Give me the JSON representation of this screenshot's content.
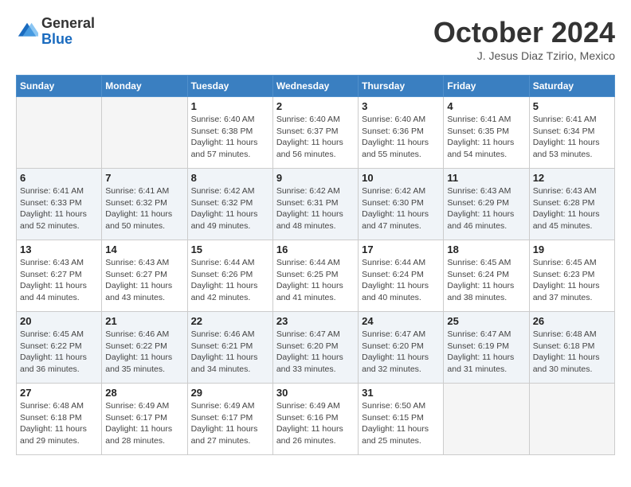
{
  "logo": {
    "general": "General",
    "blue": "Blue"
  },
  "title": "October 2024",
  "subtitle": "J. Jesus Diaz Tzirio, Mexico",
  "days_of_week": [
    "Sunday",
    "Monday",
    "Tuesday",
    "Wednesday",
    "Thursday",
    "Friday",
    "Saturday"
  ],
  "weeks": [
    [
      {
        "day": "",
        "detail": ""
      },
      {
        "day": "",
        "detail": ""
      },
      {
        "day": "1",
        "detail": "Sunrise: 6:40 AM\nSunset: 6:38 PM\nDaylight: 11 hours and 57 minutes."
      },
      {
        "day": "2",
        "detail": "Sunrise: 6:40 AM\nSunset: 6:37 PM\nDaylight: 11 hours and 56 minutes."
      },
      {
        "day": "3",
        "detail": "Sunrise: 6:40 AM\nSunset: 6:36 PM\nDaylight: 11 hours and 55 minutes."
      },
      {
        "day": "4",
        "detail": "Sunrise: 6:41 AM\nSunset: 6:35 PM\nDaylight: 11 hours and 54 minutes."
      },
      {
        "day": "5",
        "detail": "Sunrise: 6:41 AM\nSunset: 6:34 PM\nDaylight: 11 hours and 53 minutes."
      }
    ],
    [
      {
        "day": "6",
        "detail": "Sunrise: 6:41 AM\nSunset: 6:33 PM\nDaylight: 11 hours and 52 minutes."
      },
      {
        "day": "7",
        "detail": "Sunrise: 6:41 AM\nSunset: 6:32 PM\nDaylight: 11 hours and 50 minutes."
      },
      {
        "day": "8",
        "detail": "Sunrise: 6:42 AM\nSunset: 6:32 PM\nDaylight: 11 hours and 49 minutes."
      },
      {
        "day": "9",
        "detail": "Sunrise: 6:42 AM\nSunset: 6:31 PM\nDaylight: 11 hours and 48 minutes."
      },
      {
        "day": "10",
        "detail": "Sunrise: 6:42 AM\nSunset: 6:30 PM\nDaylight: 11 hours and 47 minutes."
      },
      {
        "day": "11",
        "detail": "Sunrise: 6:43 AM\nSunset: 6:29 PM\nDaylight: 11 hours and 46 minutes."
      },
      {
        "day": "12",
        "detail": "Sunrise: 6:43 AM\nSunset: 6:28 PM\nDaylight: 11 hours and 45 minutes."
      }
    ],
    [
      {
        "day": "13",
        "detail": "Sunrise: 6:43 AM\nSunset: 6:27 PM\nDaylight: 11 hours and 44 minutes."
      },
      {
        "day": "14",
        "detail": "Sunrise: 6:43 AM\nSunset: 6:27 PM\nDaylight: 11 hours and 43 minutes."
      },
      {
        "day": "15",
        "detail": "Sunrise: 6:44 AM\nSunset: 6:26 PM\nDaylight: 11 hours and 42 minutes."
      },
      {
        "day": "16",
        "detail": "Sunrise: 6:44 AM\nSunset: 6:25 PM\nDaylight: 11 hours and 41 minutes."
      },
      {
        "day": "17",
        "detail": "Sunrise: 6:44 AM\nSunset: 6:24 PM\nDaylight: 11 hours and 40 minutes."
      },
      {
        "day": "18",
        "detail": "Sunrise: 6:45 AM\nSunset: 6:24 PM\nDaylight: 11 hours and 38 minutes."
      },
      {
        "day": "19",
        "detail": "Sunrise: 6:45 AM\nSunset: 6:23 PM\nDaylight: 11 hours and 37 minutes."
      }
    ],
    [
      {
        "day": "20",
        "detail": "Sunrise: 6:45 AM\nSunset: 6:22 PM\nDaylight: 11 hours and 36 minutes."
      },
      {
        "day": "21",
        "detail": "Sunrise: 6:46 AM\nSunset: 6:22 PM\nDaylight: 11 hours and 35 minutes."
      },
      {
        "day": "22",
        "detail": "Sunrise: 6:46 AM\nSunset: 6:21 PM\nDaylight: 11 hours and 34 minutes."
      },
      {
        "day": "23",
        "detail": "Sunrise: 6:47 AM\nSunset: 6:20 PM\nDaylight: 11 hours and 33 minutes."
      },
      {
        "day": "24",
        "detail": "Sunrise: 6:47 AM\nSunset: 6:20 PM\nDaylight: 11 hours and 32 minutes."
      },
      {
        "day": "25",
        "detail": "Sunrise: 6:47 AM\nSunset: 6:19 PM\nDaylight: 11 hours and 31 minutes."
      },
      {
        "day": "26",
        "detail": "Sunrise: 6:48 AM\nSunset: 6:18 PM\nDaylight: 11 hours and 30 minutes."
      }
    ],
    [
      {
        "day": "27",
        "detail": "Sunrise: 6:48 AM\nSunset: 6:18 PM\nDaylight: 11 hours and 29 minutes."
      },
      {
        "day": "28",
        "detail": "Sunrise: 6:49 AM\nSunset: 6:17 PM\nDaylight: 11 hours and 28 minutes."
      },
      {
        "day": "29",
        "detail": "Sunrise: 6:49 AM\nSunset: 6:17 PM\nDaylight: 11 hours and 27 minutes."
      },
      {
        "day": "30",
        "detail": "Sunrise: 6:49 AM\nSunset: 6:16 PM\nDaylight: 11 hours and 26 minutes."
      },
      {
        "day": "31",
        "detail": "Sunrise: 6:50 AM\nSunset: 6:15 PM\nDaylight: 11 hours and 25 minutes."
      },
      {
        "day": "",
        "detail": ""
      },
      {
        "day": "",
        "detail": ""
      }
    ]
  ]
}
